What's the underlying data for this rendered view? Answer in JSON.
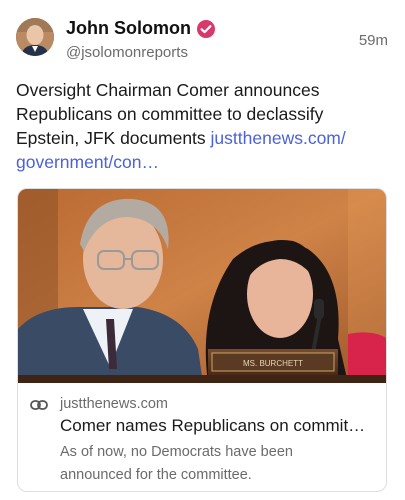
{
  "post": {
    "author": {
      "name": "John Solomon",
      "handle": "@jsolomonreports",
      "verified_color": "#d63a6a"
    },
    "timestamp": "59m",
    "text": "Oversight Chairman Comer announces Republicans on committee to declassify Epstein, JFK documents",
    "link_text": "justthenews.com/ government/con…",
    "link_color": "#4b62d8"
  },
  "link_card": {
    "domain": "justthenews.com",
    "title": "Comer names Republicans on commit…",
    "description": "As of now, no Democrats have been announced for the committee.",
    "nameplate": "MS. BURCHETT",
    "icon": "link-icon"
  }
}
